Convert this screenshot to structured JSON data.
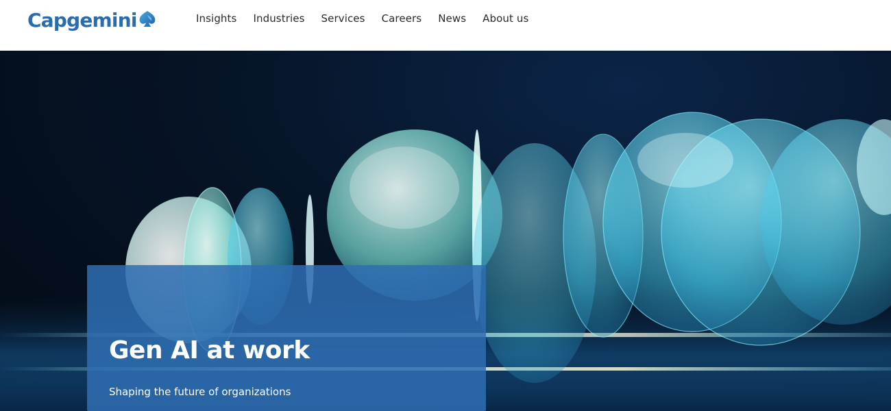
{
  "brand": {
    "name": "Capgemini",
    "color": "#2b6cb0"
  },
  "nav": {
    "items": [
      {
        "label": "Insights"
      },
      {
        "label": "Industries"
      },
      {
        "label": "Services"
      },
      {
        "label": "Careers"
      },
      {
        "label": "News"
      },
      {
        "label": "About us"
      }
    ]
  },
  "hero": {
    "title": "Gen AI at work",
    "subtitle": "Shaping the future of organizations",
    "card_color": "#2e6eb2"
  }
}
